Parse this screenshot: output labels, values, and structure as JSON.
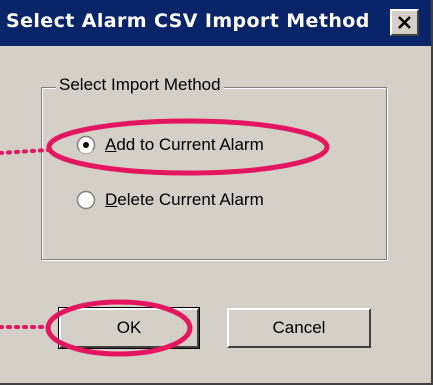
{
  "window": {
    "title": "Select Alarm CSV Import Method"
  },
  "group": {
    "label": "Select Import Method"
  },
  "options": [
    {
      "label": "Add to Current Alarm",
      "selected": true
    },
    {
      "label": "Delete Current Alarm",
      "selected": false
    }
  ],
  "buttons": {
    "ok": "OK",
    "cancel": "Cancel"
  },
  "annotation": {
    "color": "#e4165f"
  }
}
